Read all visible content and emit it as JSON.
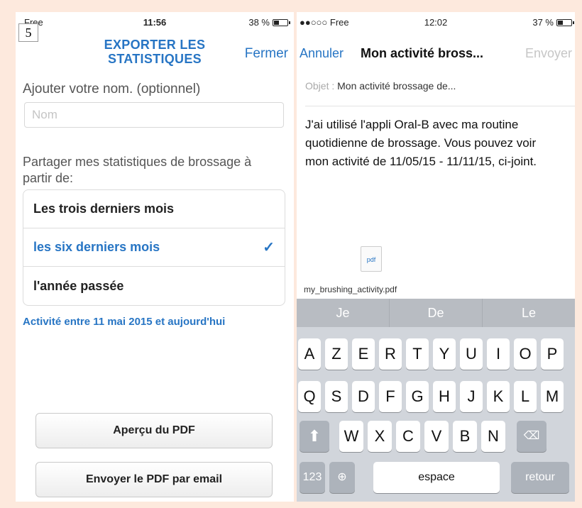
{
  "step_number": "5",
  "left_screen": {
    "status": {
      "carrier": "Free",
      "time": "11:56",
      "battery": "38 %",
      "battery_level": 0.38
    },
    "title": "EXPORTER LES STATISTIQUES",
    "close_label": "Fermer",
    "name_label": "Ajouter votre nom. (optionnel)",
    "name_placeholder": "Nom",
    "share_label": "Partager mes statistiques de brossage à partir de:",
    "options": [
      {
        "label": "Les trois derniers mois",
        "selected": false
      },
      {
        "label": "les six derniers mois",
        "selected": true
      },
      {
        "label": "l'année passée",
        "selected": false
      }
    ],
    "check_mark": "✓",
    "range_text": "Activité entre 11 mai 2015 et aujourd'hui",
    "preview_button": "Aperçu du PDF",
    "email_button": "Envoyer le PDF par email"
  },
  "right_screen": {
    "status": {
      "carrier": "●●○○○ Free",
      "time": "12:02",
      "battery": "37 %",
      "battery_level": 0.37
    },
    "cancel_label": "Annuler",
    "subject_title": "Mon activité bross...",
    "send_label": "Envoyer",
    "object_label": "Objet :",
    "object_value": "Mon activité brossage de...",
    "body": "J'ai utilisé l'appli Oral-B avec ma routine quotidienne de brossage. Vous pouvez voir mon activité de 11/05/15 - 11/11/15, ci-joint.",
    "attachment_icon_label": "pdf",
    "attachment_name": "my_brushing_activity.pdf",
    "keyboard": {
      "suggestions": [
        "Je",
        "De",
        "Le"
      ],
      "row1": [
        "A",
        "Z",
        "E",
        "R",
        "T",
        "Y",
        "U",
        "I",
        "O",
        "P"
      ],
      "row2": [
        "Q",
        "S",
        "D",
        "F",
        "G",
        "H",
        "J",
        "K",
        "L",
        "M"
      ],
      "row3": [
        "W",
        "X",
        "C",
        "V",
        "B",
        "N"
      ],
      "numbers_key": "123",
      "space_key": "espace",
      "return_key": "retour"
    }
  },
  "colors": {
    "accent": "#2775c4",
    "background": "#fde9dd",
    "keyboard": "#d1d5db"
  }
}
